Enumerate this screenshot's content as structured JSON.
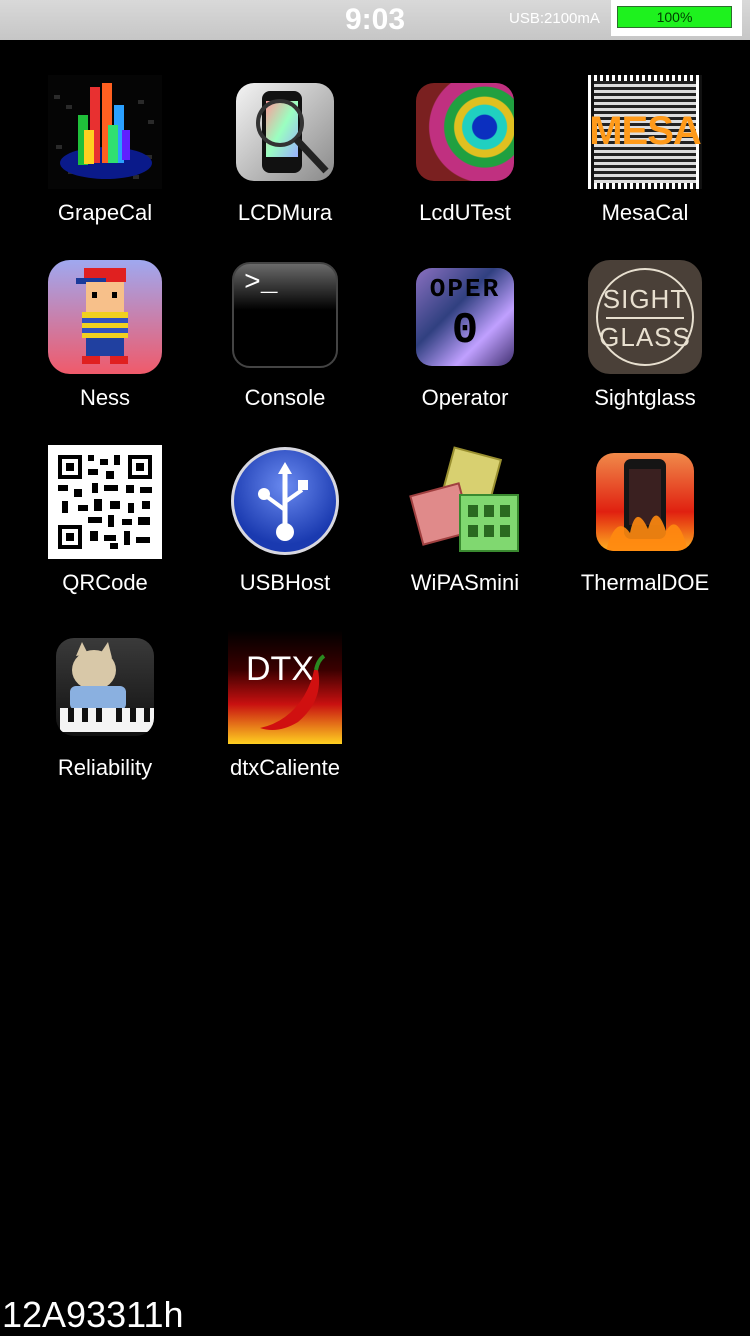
{
  "status_bar": {
    "time": "9:03",
    "usb": "USB:2100mA",
    "battery": "100%",
    "battery_color": "#1ef21e"
  },
  "apps": [
    {
      "label": "GrapeCal",
      "icon": "grapecal-icon"
    },
    {
      "label": "LCDMura",
      "icon": "lcdmura-icon"
    },
    {
      "label": "LcdUTest",
      "icon": "lcdutest-icon"
    },
    {
      "label": "MesaCal",
      "icon": "mesacal-icon",
      "icon_text": "MESA"
    },
    {
      "label": "Ness",
      "icon": "ness-icon"
    },
    {
      "label": "Console",
      "icon": "console-icon",
      "icon_text": ">_"
    },
    {
      "label": "Operator",
      "icon": "operator-icon",
      "icon_text": "OPER",
      "icon_text2": "0"
    },
    {
      "label": "Sightglass",
      "icon": "sightglass-icon",
      "icon_text": "SIGHT",
      "icon_text2": "GLASS"
    },
    {
      "label": "QRCode",
      "icon": "qrcode-icon"
    },
    {
      "label": "USBHost",
      "icon": "usbhost-icon"
    },
    {
      "label": "WiPASmini",
      "icon": "wipasmini-icon"
    },
    {
      "label": "ThermalDOE",
      "icon": "thermaldoe-icon"
    },
    {
      "label": "Reliability",
      "icon": "reliability-icon"
    },
    {
      "label": "dtxCaliente",
      "icon": "dtxcaliente-icon",
      "icon_text": "DTX"
    }
  ],
  "footer": {
    "build": "12A93311h"
  }
}
